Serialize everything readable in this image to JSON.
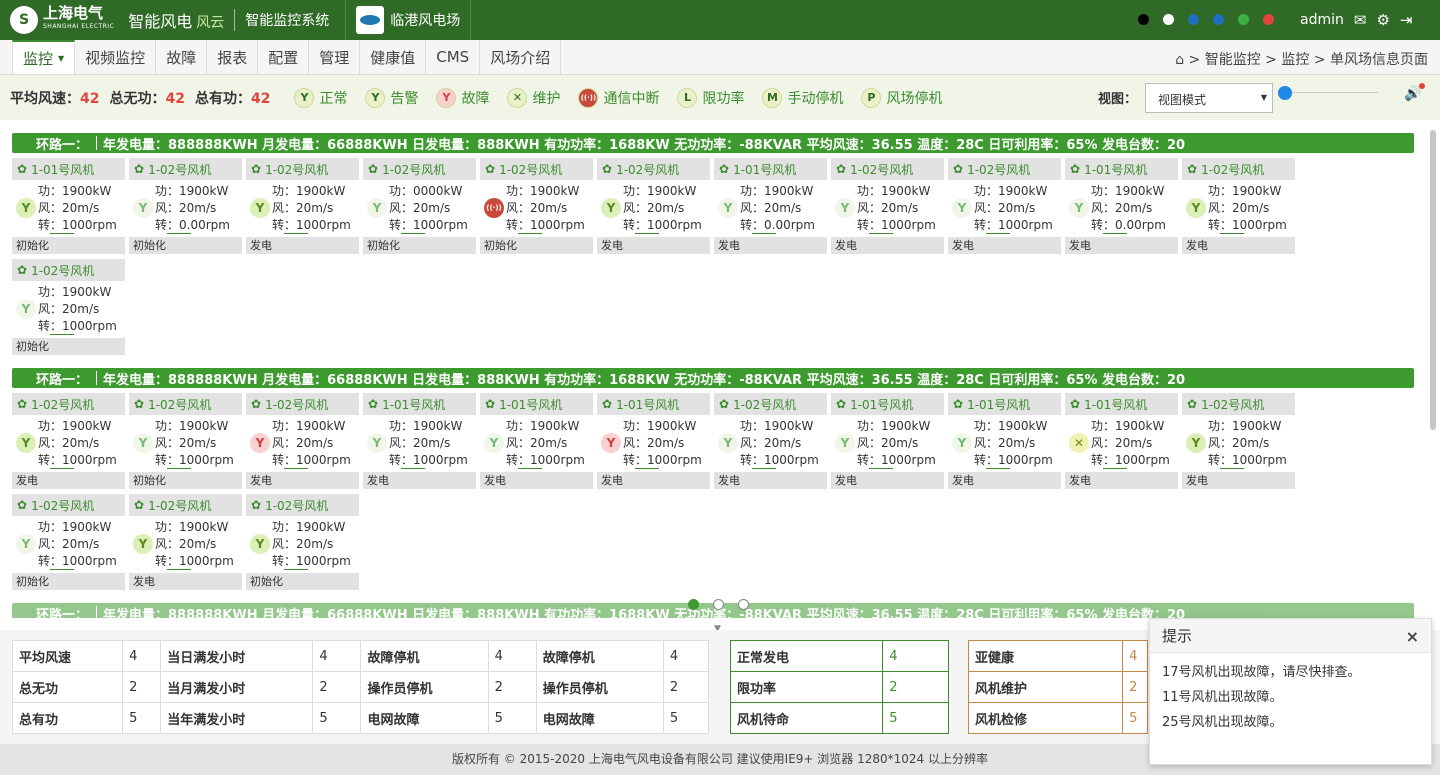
{
  "header": {
    "brand": "上海电气",
    "brand_sub": "SHANGHAI ELECTRIC",
    "product": "智能风电",
    "product_tag": "风云",
    "system": "智能监控系统",
    "farm": "临港风电场",
    "user": "admin",
    "theme_dots": [
      "#000000",
      "#ffffff",
      "#1f6fbf",
      "#1f6fbf",
      "#3cb043",
      "#e0443a"
    ]
  },
  "menu": [
    "监控",
    "视频监控",
    "故障",
    "报表",
    "配置",
    "管理",
    "健康值",
    "CMS",
    "风场介绍"
  ],
  "breadcrumb": "智能监控 > 监控 > 单风场信息页面",
  "stats": {
    "wind_label": "平均风速：",
    "wind_value": "42",
    "reactive_label": "总无功：",
    "reactive_value": "42",
    "active_label": "总有功：",
    "active_value": "42"
  },
  "legend": [
    {
      "icon": "normal",
      "label": "正常"
    },
    {
      "icon": "alarm",
      "label": "告警"
    },
    {
      "icon": "fault",
      "label": "故障"
    },
    {
      "icon": "maint",
      "label": "维护"
    },
    {
      "icon": "comm",
      "label": "通信中断"
    },
    {
      "icon": "L",
      "label": "限功率"
    },
    {
      "icon": "M",
      "label": "手动停机"
    },
    {
      "icon": "P",
      "label": "风场停机"
    }
  ],
  "view": {
    "label": "视图：",
    "selected": "视图模式"
  },
  "loop_header": {
    "name": "环路一：",
    "text": "年发电量：888888KWH  月发电量：66888KWH  日发电量：888KWH  有功功率：1688KW  无功功率：-88KVAR  平均风速：36.55  温度：28C  日可利用率：65%  发电台数：20"
  },
  "loops": [
    {
      "turbines": [
        {
          "name": "1-01号风机",
          "power": "功：1900kW",
          "wind": "风：20m/s",
          "rpm": "转：1000rpm",
          "status": "初始化",
          "kind": "green"
        },
        {
          "name": "1-02号风机",
          "power": "功：1900kW",
          "wind": "风：20m/s",
          "rpm": "转：0.00rpm",
          "status": "初始化",
          "kind": "lightgreen"
        },
        {
          "name": "1-02号风机",
          "power": "功：1900kW",
          "wind": "风：20m/s",
          "rpm": "转：1000rpm",
          "status": "发电",
          "kind": "green"
        },
        {
          "name": "1-02号风机",
          "power": "功：0000kW",
          "wind": "风：20m/s",
          "rpm": "转：1000rpm",
          "status": "初始化",
          "kind": "lightgreen"
        },
        {
          "name": "1-02号风机",
          "power": "功：1900kW",
          "wind": "风：20m/s",
          "rpm": "转：1000rpm",
          "status": "初始化",
          "kind": "fault"
        },
        {
          "name": "1-02号风机",
          "power": "功：1900kW",
          "wind": "风：20m/s",
          "rpm": "转：1000rpm",
          "status": "发电",
          "kind": "green"
        },
        {
          "name": "1-01号风机",
          "power": "功：1900kW",
          "wind": "风：20m/s",
          "rpm": "转：0.00rpm",
          "status": "发电",
          "kind": "lightgreen"
        },
        {
          "name": "1-02号风机",
          "power": "功：1900kW",
          "wind": "风：20m/s",
          "rpm": "转：1000rpm",
          "status": "发电",
          "kind": "lightgreen"
        },
        {
          "name": "1-02号风机",
          "power": "功：1900kW",
          "wind": "风：20m/s",
          "rpm": "转：1000rpm",
          "status": "发电",
          "kind": "lightgreen"
        },
        {
          "name": "1-01号风机",
          "power": "功：1900kW",
          "wind": "风：20m/s",
          "rpm": "转：0.00rpm",
          "status": "发电",
          "kind": "lightgreen"
        },
        {
          "name": "1-02号风机",
          "power": "功：1900kW",
          "wind": "风：20m/s",
          "rpm": "转：1000rpm",
          "status": "发电",
          "kind": "green"
        },
        {
          "name": "1-02号风机",
          "power": "功：1900kW",
          "wind": "风：20m/s",
          "rpm": "转：1000rpm",
          "status": "初始化",
          "kind": "lightgreen"
        }
      ]
    },
    {
      "turbines": [
        {
          "name": "1-02号风机",
          "power": "功：1900kW",
          "wind": "风：20m/s",
          "rpm": "转：1000rpm",
          "status": "发电",
          "kind": "green"
        },
        {
          "name": "1-02号风机",
          "power": "功：1900kW",
          "wind": "风：20m/s",
          "rpm": "转：1000rpm",
          "status": "初始化",
          "kind": "lightgreen"
        },
        {
          "name": "1-02号风机",
          "power": "功：1900kW",
          "wind": "风：20m/s",
          "rpm": "转：1000rpm",
          "status": "发电",
          "kind": "red"
        },
        {
          "name": "1-01号风机",
          "power": "功：1900kW",
          "wind": "风：20m/s",
          "rpm": "转：1000rpm",
          "status": "发电",
          "kind": "lightgreen"
        },
        {
          "name": "1-01号风机",
          "power": "功：1900kW",
          "wind": "风：20m/s",
          "rpm": "转：1000rpm",
          "status": "发电",
          "kind": "lightgreen"
        },
        {
          "name": "1-01号风机",
          "power": "功：1900kW",
          "wind": "风：20m/s",
          "rpm": "转：1000rpm",
          "status": "发电",
          "kind": "red"
        },
        {
          "name": "1-02号风机",
          "power": "功：1900kW",
          "wind": "风：20m/s",
          "rpm": "转：1000rpm",
          "status": "发电",
          "kind": "lightgreen"
        },
        {
          "name": "1-01号风机",
          "power": "功：1900kW",
          "wind": "风：20m/s",
          "rpm": "转：1000rpm",
          "status": "发电",
          "kind": "lightgreen"
        },
        {
          "name": "1-01号风机",
          "power": "功：1900kW",
          "wind": "风：20m/s",
          "rpm": "转：1000rpm",
          "status": "发电",
          "kind": "lightgreen"
        },
        {
          "name": "1-01号风机",
          "power": "功：1900kW",
          "wind": "风：20m/s",
          "rpm": "转：1000rpm",
          "status": "发电",
          "kind": "maint"
        },
        {
          "name": "1-02号风机",
          "power": "功：1900kW",
          "wind": "风：20m/s",
          "rpm": "转：1000rpm",
          "status": "发电",
          "kind": "green"
        },
        {
          "name": "1-02号风机",
          "power": "功：1900kW",
          "wind": "风：20m/s",
          "rpm": "转：1000rpm",
          "status": "初始化",
          "kind": "lightgreen"
        },
        {
          "name": "1-02号风机",
          "power": "功：1900kW",
          "wind": "风：20m/s",
          "rpm": "转：1000rpm",
          "status": "发电",
          "kind": "green"
        },
        {
          "name": "1-02号风机",
          "power": "功：1900kW",
          "wind": "风：20m/s",
          "rpm": "转：1000rpm",
          "status": "初始化",
          "kind": "green"
        }
      ]
    }
  ],
  "summary": {
    "rows": [
      [
        "平均风速",
        "4",
        "当日满发小时",
        "4",
        "故障停机",
        "4",
        "故障停机",
        "4"
      ],
      [
        "总无功",
        "2",
        "当月满发小时",
        "2",
        "操作员停机",
        "2",
        "操作员停机",
        "2"
      ],
      [
        "总有功",
        "5",
        "当年满发小时",
        "5",
        "电网故障",
        "5",
        "电网故障",
        "5"
      ]
    ],
    "green": [
      [
        "正常发电",
        "4"
      ],
      [
        "限功率",
        "2"
      ],
      [
        "风机待命",
        "5"
      ]
    ],
    "orange": [
      [
        "亚健康",
        "4"
      ],
      [
        "风机维护",
        "2"
      ],
      [
        "风机检修",
        "5"
      ]
    ]
  },
  "footer": "版权所有 © 2015-2020 上海电气风电设备有限公司 建议使用IE9+ 浏览器 1280*1024 以上分辨率",
  "popup": {
    "title": "提示",
    "close": "×",
    "messages": [
      "17号风机出现故障，请尽快排查。",
      "11号风机出现故障。",
      "25号风机出现故障。"
    ]
  }
}
